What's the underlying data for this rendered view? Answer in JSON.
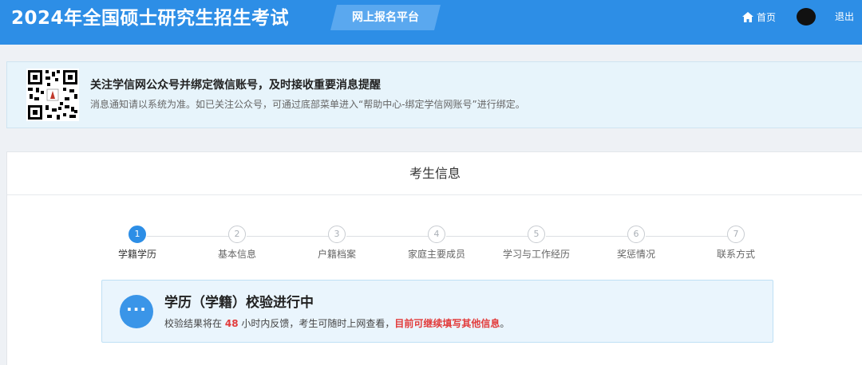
{
  "header": {
    "title": "2024年全国硕士研究生招生考试",
    "platform": "网上报名平台",
    "home": "首页",
    "logout": "退出"
  },
  "notice": {
    "title": "关注学信网公众号并绑定微信账号，及时接收重要消息提醒",
    "description": "消息通知请以系统为准。如已关注公众号，可通过底部菜单进入“帮助中心-绑定学信网账号”进行绑定。"
  },
  "card": {
    "title": "考生信息"
  },
  "steps": [
    {
      "number": "1",
      "label": "学籍学历",
      "active": true
    },
    {
      "number": "2",
      "label": "基本信息",
      "active": false
    },
    {
      "number": "3",
      "label": "户籍档案",
      "active": false
    },
    {
      "number": "4",
      "label": "家庭主要成员",
      "active": false
    },
    {
      "number": "5",
      "label": "学习与工作经历",
      "active": false
    },
    {
      "number": "6",
      "label": "奖惩情况",
      "active": false
    },
    {
      "number": "7",
      "label": "联系方式",
      "active": false
    }
  ],
  "verify": {
    "icon": "ellipsis-icon",
    "dots": "···",
    "title": "学历（学籍）校验进行中",
    "desc_prefix": "校验结果将在",
    "desc_hours": "48",
    "desc_middle": "小时内反馈，考生可随时上网查看，",
    "desc_highlight": "目前可继续填写其他信息",
    "desc_suffix": "。"
  },
  "colors": {
    "header_blue": "#2d8ee6",
    "highlight_red": "#e23b3b"
  }
}
